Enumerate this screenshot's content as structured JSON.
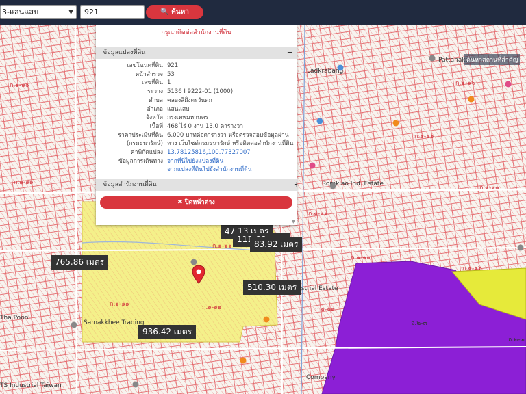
{
  "search": {
    "district_value": "3-แสนแสบ",
    "parcel_value": "921",
    "button_label": "ค้นหา"
  },
  "popup": {
    "warning": "กรุณาติดต่อสำนักงานที่ดิน",
    "section1_title": "ข้อมูลแปลงที่ดิน",
    "section1_toggle": "−",
    "fields": [
      {
        "k": "เลขโฉนดที่ดิน",
        "v": "921"
      },
      {
        "k": "หน้าสำรวจ",
        "v": "53"
      },
      {
        "k": "เลขที่ดิน",
        "v": "1"
      },
      {
        "k": "ระวาง",
        "v": "5136 I 9222-01 (1000)"
      },
      {
        "k": "ตำบล",
        "v": "คลองสี่ฝั่งตะวันตก"
      },
      {
        "k": "อำเภอ",
        "v": "แสนแสบ"
      },
      {
        "k": "จังหวัด",
        "v": "กรุงเทพมหานคร"
      },
      {
        "k": "เนื้อที่",
        "v": "468 ไร่ 0 งาน 13.0 ตารางวา"
      },
      {
        "k": "ราคาประเมินที่ดิน",
        "v": "6,000 บาทต่อตารางวา หรือตรวจสอบข้อมูลผ่าน"
      },
      {
        "k": "(กรมธนารักษ์)",
        "v": "ทาง เว็บไซต์กรมธนารักษ์ หรือติดต่อสำนักงานที่ดิน"
      },
      {
        "k": "ค่าพิกัดแปลง",
        "v": "13.78125816,100.77327007",
        "link": true
      },
      {
        "k": "ข้อมูลการเดินทาง",
        "v": "จากที่นี่ไปยังแปลงที่ดิน",
        "link": true
      },
      {
        "k": "",
        "v": "จากแปลงที่ดินไปยังสำนักงานที่ดิน",
        "link": true
      }
    ],
    "section2_title": "ข้อมูลสำนักงานที่ดิน",
    "section2_toggle": "+",
    "close_label": "✖ ปิดหน้าต่าง"
  },
  "map": {
    "brand": "ค้นหาสถานที่สำคัญ",
    "distances": [
      "47.13 เมตร",
      "111.66 เมตร",
      "83.92 เมตร",
      "765.86 เมตร",
      "510.30 เมตร",
      "936.42 เมตร"
    ],
    "road_labels": [
      "ก.๑-๑๐",
      "ก.๑-๑๑",
      "ก.๑-๑๑",
      "ก.๑-๑๑",
      "ก.๑-๑๑",
      "ก.๑-๑๑",
      "ก.๑-๑๑",
      "ก.๑-๑๖",
      "ก.๑-๑๑",
      "ก.๑-๑๖",
      "ก.๑-๑๑",
      "อ.๒-๓",
      "อ.๒-๓",
      "ก.๑-๑๑"
    ],
    "place_labels": [
      "Romklao Ind. Estate",
      "Ladkrabang",
      "Pattanakarn",
      "Samakkhee Trading",
      "Tha Poon",
      "Industrial Estate",
      "TS Industrial Taiwan",
      "Company"
    ],
    "zone_colors": {
      "yellow": "#f4f08a",
      "purple": "#8c1fd6",
      "lime": "#e6ea3a",
      "hatch": "#e43a3a"
    }
  }
}
